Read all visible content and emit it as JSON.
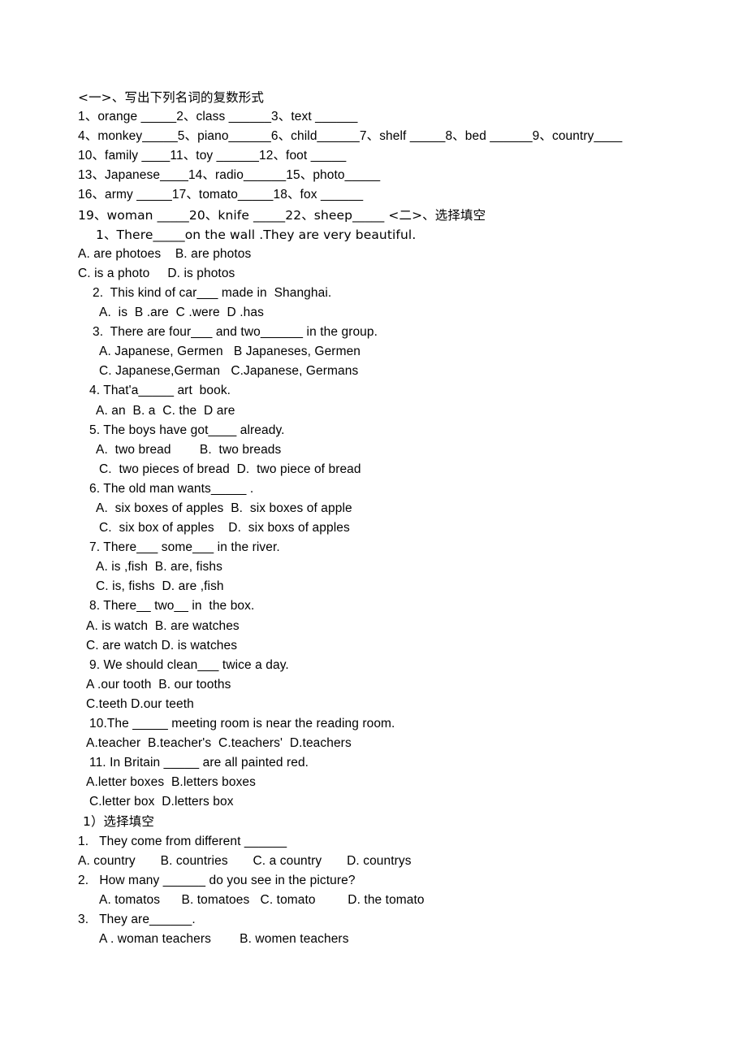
{
  "document": {
    "section_one_heading": "<一>、写出下列名词的复数形式",
    "noun_plural_lines": [
      "1、orange _____2、class ______3、text ______",
      "4、monkey_____5、piano______6、child______7、shelf _____8、bed ______9、country____",
      "10、family ____11、toy ______12、foot _____",
      "13、Japanese____14、radio______15、photo_____",
      "16、army _____17、tomato_____18、fox ______",
      "19、woman _____20、knife _____22、sheep_____ <二>、选择填空"
    ],
    "section_two_questions": [
      {
        "stem": "1、There_____on the wall .They are very beautiful.",
        "stem_indent": "ind-4",
        "option_lines": [
          {
            "text": "A. are photoes    B. are photos",
            "indent": "ind-0"
          },
          {
            "text": "C. is a photo     D. is photos",
            "indent": "ind-0"
          }
        ]
      },
      {
        "stem": "2.  This kind of car___ made in  Shanghai.",
        "stem_indent": "ind-3",
        "option_lines": [
          {
            "text": "A.  is  B .are  C .were  D .has",
            "indent": "ind-5"
          }
        ]
      },
      {
        "stem": "3.  There are four___ and two______ in the group.",
        "stem_indent": "ind-3",
        "option_lines": [
          {
            "text": "A. Japanese, Germen   B Japaneses, Germen",
            "indent": "ind-5"
          },
          {
            "text": "C. Japanese,German   C.Japanese, Germans",
            "indent": "ind-5"
          }
        ]
      },
      {
        "stem": "4. That'a_____ art  book.",
        "stem_indent": "ind-2",
        "option_lines": [
          {
            "text": "A. an  B. a  C. the  D are",
            "indent": "ind-4"
          }
        ]
      },
      {
        "stem": "5. The boys have got____ already.",
        "stem_indent": "ind-2",
        "option_lines": [
          {
            "text": "A.  two bread        B.  two breads",
            "indent": "ind-4"
          },
          {
            "text": "C.  two pieces of bread  D.  two piece of bread",
            "indent": "ind-5"
          }
        ]
      },
      {
        "stem": "6. The old man wants_____ .",
        "stem_indent": "ind-2",
        "option_lines": [
          {
            "text": "A.  six boxes of apples  B.  six boxes of apple",
            "indent": "ind-4"
          },
          {
            "text": "C.  six box of apples    D.  six boxs of apples",
            "indent": "ind-5"
          }
        ]
      },
      {
        "stem": "7. There___ some___ in the river.",
        "stem_indent": "ind-2",
        "option_lines": [
          {
            "text": "A. is ,fish  B. are, fishs",
            "indent": "ind-4"
          },
          {
            "text": "C. is, fishs  D. are ,fish",
            "indent": "ind-4"
          }
        ]
      },
      {
        "stem": "8. There__ two__ in  the box.",
        "stem_indent": "ind-2",
        "option_lines": [
          {
            "text": "A. is watch  B. are watches",
            "indent": "ind-1"
          },
          {
            "text": "C. are watch D. is watches",
            "indent": "ind-1"
          }
        ]
      },
      {
        "stem": "9. We should clean___ twice a day.",
        "stem_indent": "ind-2",
        "option_lines": [
          {
            "text": "A .our tooth  B. our tooths",
            "indent": "ind-1"
          },
          {
            "text": "C.teeth D.our teeth",
            "indent": "ind-1"
          }
        ]
      },
      {
        "stem": "10.The _____ meeting room is near the reading room.",
        "stem_indent": "ind-2",
        "option_lines": [
          {
            "text": "A.teacher  B.teacher's  C.teachers'  D.teachers",
            "indent": "ind-1"
          }
        ]
      },
      {
        "stem": "11. In Britain _____ are all painted red.",
        "stem_indent": "ind-2",
        "option_lines": [
          {
            "text": "A.letter boxes  B.letters boxes",
            "indent": "ind-1"
          },
          {
            "text": "C.letter box  D.letters box",
            "indent": "ind-2"
          }
        ]
      }
    ],
    "section_three_heading": "1）选择填空",
    "section_three_questions": [
      {
        "stem": "1.   They come from different ______",
        "stem_indent": "ind-0",
        "option_lines": [
          {
            "text": "A. country       B. countries       C. a country       D. countrys",
            "indent": "ind-0"
          }
        ]
      },
      {
        "stem": "2.   How many ______ do you see in the picture?",
        "stem_indent": "ind-0",
        "option_lines": [
          {
            "text": "A. tomatos      B. tomatoes   C. tomato         D. the tomato",
            "indent": "ind-5"
          }
        ]
      },
      {
        "stem": "3.   They are______.",
        "stem_indent": "ind-0",
        "option_lines": [
          {
            "text": "A . woman teachers        B. women teachers",
            "indent": "ind-5"
          }
        ]
      }
    ]
  }
}
